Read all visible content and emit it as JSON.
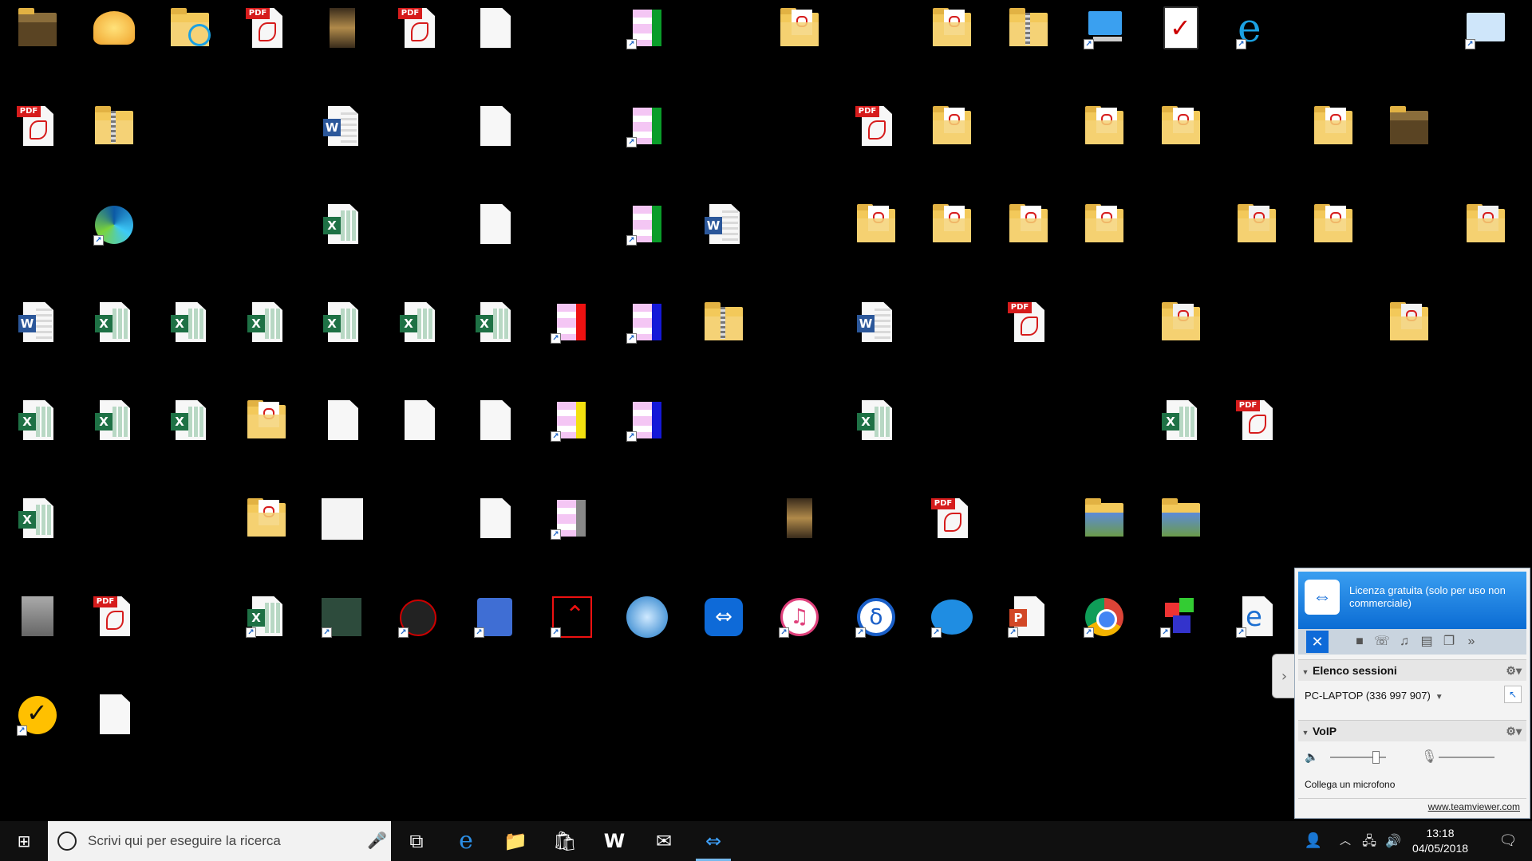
{
  "desktop": {
    "icons": [
      {
        "col": 0,
        "row": 0,
        "kind": "folder-dark",
        "label": ""
      },
      {
        "col": 1,
        "row": 0,
        "kind": "shell",
        "label": ""
      },
      {
        "col": 2,
        "row": 0,
        "kind": "folder-ie",
        "label": ""
      },
      {
        "col": 3,
        "row": 0,
        "kind": "pdf",
        "label": ""
      },
      {
        "col": 4,
        "row": 0,
        "kind": "photo",
        "label": ""
      },
      {
        "col": 5,
        "row": 0,
        "kind": "pdf",
        "label": ""
      },
      {
        "col": 6,
        "row": 0,
        "kind": "blank",
        "label": ""
      },
      {
        "col": 8,
        "row": 0,
        "kind": "tile-green",
        "label": "",
        "shortcut": true
      },
      {
        "col": 10,
        "row": 0,
        "kind": "folder-pdf",
        "label": ""
      },
      {
        "col": 12,
        "row": 0,
        "kind": "folder-pdf",
        "label": ""
      },
      {
        "col": 13,
        "row": 0,
        "kind": "folder-zip",
        "label": ""
      },
      {
        "col": 14,
        "row": 0,
        "kind": "computer",
        "label": "",
        "shortcut": true
      },
      {
        "col": 15,
        "row": 0,
        "kind": "clipboard",
        "label": ""
      },
      {
        "col": 16,
        "row": 0,
        "kind": "ie",
        "label": "",
        "shortcut": true
      },
      {
        "col": 19,
        "row": 0,
        "kind": "mail-app",
        "label": "",
        "shortcut": true
      },
      {
        "col": 0,
        "row": 1,
        "kind": "pdf",
        "label": ""
      },
      {
        "col": 1,
        "row": 1,
        "kind": "folder-zip",
        "label": ""
      },
      {
        "col": 4,
        "row": 1,
        "kind": "word",
        "label": ""
      },
      {
        "col": 6,
        "row": 1,
        "kind": "blank",
        "label": ""
      },
      {
        "col": 8,
        "row": 1,
        "kind": "tile-green",
        "label": "",
        "shortcut": true
      },
      {
        "col": 11,
        "row": 1,
        "kind": "pdf",
        "label": ""
      },
      {
        "col": 12,
        "row": 1,
        "kind": "folder-pdf",
        "label": ""
      },
      {
        "col": 14,
        "row": 1,
        "kind": "folder-pdf",
        "label": ""
      },
      {
        "col": 15,
        "row": 1,
        "kind": "folder-pdf",
        "label": ""
      },
      {
        "col": 17,
        "row": 1,
        "kind": "folder-pdf",
        "label": ""
      },
      {
        "col": 18,
        "row": 1,
        "kind": "folder-dark",
        "label": ""
      },
      {
        "col": 1,
        "row": 2,
        "kind": "edge-new",
        "label": "",
        "shortcut": true
      },
      {
        "col": 4,
        "row": 2,
        "kind": "excel",
        "label": ""
      },
      {
        "col": 6,
        "row": 2,
        "kind": "blank",
        "label": ""
      },
      {
        "col": 8,
        "row": 2,
        "kind": "tile-green",
        "label": "",
        "shortcut": true
      },
      {
        "col": 9,
        "row": 2,
        "kind": "word",
        "label": ""
      },
      {
        "col": 11,
        "row": 2,
        "kind": "folder-pdf",
        "label": ""
      },
      {
        "col": 12,
        "row": 2,
        "kind": "folder-pdf",
        "label": ""
      },
      {
        "col": 13,
        "row": 2,
        "kind": "folder-pdf",
        "label": ""
      },
      {
        "col": 14,
        "row": 2,
        "kind": "folder-pdf",
        "label": ""
      },
      {
        "col": 16,
        "row": 2,
        "kind": "folder-doc",
        "label": ""
      },
      {
        "col": 17,
        "row": 2,
        "kind": "folder-pdf",
        "label": ""
      },
      {
        "col": 19,
        "row": 2,
        "kind": "folder-doc",
        "label": ""
      },
      {
        "col": 0,
        "row": 3,
        "kind": "word",
        "label": ""
      },
      {
        "col": 1,
        "row": 3,
        "kind": "excel",
        "label": ""
      },
      {
        "col": 2,
        "row": 3,
        "kind": "excel",
        "label": ""
      },
      {
        "col": 3,
        "row": 3,
        "kind": "excel",
        "label": ""
      },
      {
        "col": 4,
        "row": 3,
        "kind": "excel",
        "label": ""
      },
      {
        "col": 5,
        "row": 3,
        "kind": "excel",
        "label": ""
      },
      {
        "col": 6,
        "row": 3,
        "kind": "excel",
        "label": ""
      },
      {
        "col": 7,
        "row": 3,
        "kind": "tile-red",
        "label": "",
        "shortcut": true
      },
      {
        "col": 8,
        "row": 3,
        "kind": "tile-blue",
        "label": "",
        "shortcut": true
      },
      {
        "col": 9,
        "row": 3,
        "kind": "folder-zip",
        "label": ""
      },
      {
        "col": 11,
        "row": 3,
        "kind": "word",
        "label": ""
      },
      {
        "col": 13,
        "row": 3,
        "kind": "pdf",
        "label": ""
      },
      {
        "col": 15,
        "row": 3,
        "kind": "folder-doc",
        "label": ""
      },
      {
        "col": 18,
        "row": 3,
        "kind": "folder-doc",
        "label": ""
      },
      {
        "col": 0,
        "row": 4,
        "kind": "excel",
        "label": ""
      },
      {
        "col": 1,
        "row": 4,
        "kind": "excel",
        "label": ""
      },
      {
        "col": 2,
        "row": 4,
        "kind": "excel",
        "label": ""
      },
      {
        "col": 3,
        "row": 4,
        "kind": "folder-pdf",
        "label": ""
      },
      {
        "col": 4,
        "row": 4,
        "kind": "blank",
        "label": ""
      },
      {
        "col": 5,
        "row": 4,
        "kind": "blank",
        "label": ""
      },
      {
        "col": 6,
        "row": 4,
        "kind": "blank",
        "label": ""
      },
      {
        "col": 7,
        "row": 4,
        "kind": "tile-yellow",
        "label": "",
        "shortcut": true
      },
      {
        "col": 8,
        "row": 4,
        "kind": "tile-blue",
        "label": "",
        "shortcut": true
      },
      {
        "col": 11,
        "row": 4,
        "kind": "excel",
        "label": ""
      },
      {
        "col": 15,
        "row": 4,
        "kind": "excel",
        "label": ""
      },
      {
        "col": 16,
        "row": 4,
        "kind": "pdf",
        "label": ""
      },
      {
        "col": 0,
        "row": 5,
        "kind": "excel",
        "label": ""
      },
      {
        "col": 3,
        "row": 5,
        "kind": "folder-pdf",
        "label": ""
      },
      {
        "col": 4,
        "row": 5,
        "kind": "scan",
        "label": ""
      },
      {
        "col": 6,
        "row": 5,
        "kind": "blank",
        "label": ""
      },
      {
        "col": 7,
        "row": 5,
        "kind": "tile-gray",
        "label": "",
        "shortcut": true
      },
      {
        "col": 10,
        "row": 5,
        "kind": "photo",
        "label": ""
      },
      {
        "col": 12,
        "row": 5,
        "kind": "pdf",
        "label": ""
      },
      {
        "col": 14,
        "row": 5,
        "kind": "folder-photo",
        "label": ""
      },
      {
        "col": 15,
        "row": 5,
        "kind": "folder-photo",
        "label": ""
      },
      {
        "col": 0,
        "row": 6,
        "kind": "statue",
        "label": ""
      },
      {
        "col": 1,
        "row": 6,
        "kind": "pdf",
        "label": ""
      },
      {
        "col": 3,
        "row": 6,
        "kind": "excel-app",
        "label": "",
        "shortcut": true
      },
      {
        "col": 4,
        "row": 6,
        "kind": "app-dark",
        "label": "",
        "shortcut": true
      },
      {
        "col": 5,
        "row": 6,
        "kind": "gpu-shield",
        "label": "",
        "shortcut": true
      },
      {
        "col": 6,
        "row": 6,
        "kind": "tools-app",
        "label": "",
        "shortcut": true
      },
      {
        "col": 7,
        "row": 6,
        "kind": "acrobat",
        "label": "",
        "shortcut": true
      },
      {
        "col": 8,
        "row": 6,
        "kind": "installer",
        "label": ""
      },
      {
        "col": 9,
        "row": 6,
        "kind": "teamviewer",
        "label": ""
      },
      {
        "col": 10,
        "row": 6,
        "kind": "itunes",
        "label": "",
        "shortcut": true
      },
      {
        "col": 11,
        "row": 6,
        "kind": "delta",
        "label": "",
        "shortcut": true
      },
      {
        "col": 12,
        "row": 6,
        "kind": "openoffice",
        "label": "",
        "shortcut": true
      },
      {
        "col": 13,
        "row": 6,
        "kind": "powerpoint",
        "label": "",
        "shortcut": true
      },
      {
        "col": 14,
        "row": 6,
        "kind": "chrome",
        "label": "",
        "shortcut": true
      },
      {
        "col": 15,
        "row": 6,
        "kind": "blocks",
        "label": "",
        "shortcut": true
      },
      {
        "col": 16,
        "row": 6,
        "kind": "edge-doc",
        "label": "",
        "shortcut": true
      },
      {
        "col": 0,
        "row": 7,
        "kind": "norton",
        "label": "",
        "shortcut": true
      },
      {
        "col": 1,
        "row": 7,
        "kind": "blank",
        "label": ""
      }
    ]
  },
  "taskbar": {
    "search_placeholder": "Scrivi qui per eseguire la ricerca",
    "clock_time": "13:18",
    "clock_date": "04/05/2018",
    "apps": [
      {
        "name": "taskview",
        "glyph": "⧉"
      },
      {
        "name": "edge",
        "glyph": "e"
      },
      {
        "name": "explorer",
        "glyph": "📁"
      },
      {
        "name": "store",
        "glyph": "🛍"
      },
      {
        "name": "word",
        "glyph": "W"
      },
      {
        "name": "mail",
        "glyph": "✉"
      },
      {
        "name": "teamviewer",
        "glyph": "⇔"
      }
    ]
  },
  "teamviewer_panel": {
    "license_text": "Licenza gratuita (solo per uso non commerciale)",
    "sessions_header": "Elenco sessioni",
    "session_name": "PC-LAPTOP (336 997 907)",
    "voip_header": "VoIP",
    "mic_message": "Collega un microfono",
    "footer_link": "www.teamviewer.com",
    "speaker_volume": 0.8
  },
  "colors": {
    "desktop_bg": "#000000",
    "taskbar_bg": "#101010",
    "teamviewer_blue": "#0e6ad8",
    "pdf_red": "#d61c1c",
    "excel_green": "#1e7145",
    "word_blue": "#2b579a"
  }
}
